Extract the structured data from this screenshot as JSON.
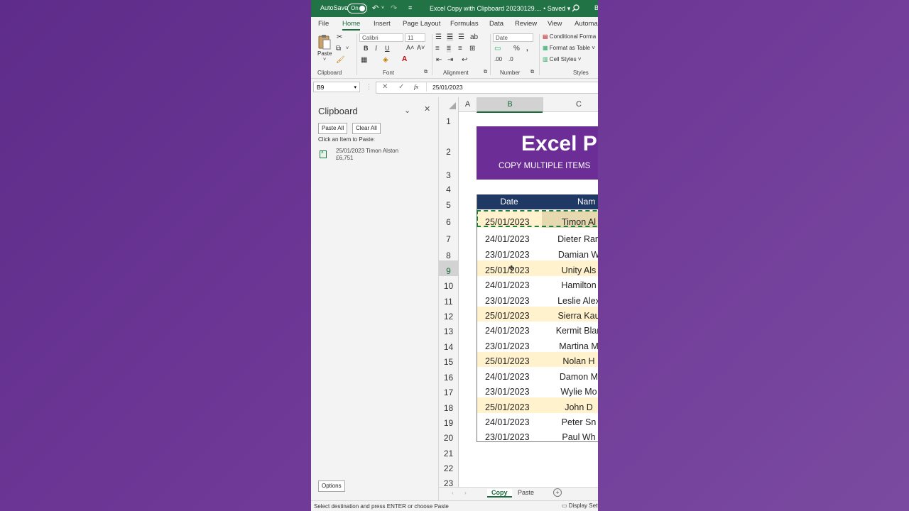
{
  "titlebar": {
    "autosave_label": "AutoSave",
    "toggle_state": "On",
    "doc_title": "Excel Copy with Clipboard 20230129.... • Saved ▾",
    "search_icon": "search-icon",
    "accent_color": "#217346"
  },
  "ribbon_tabs": [
    "File",
    "Home",
    "Insert",
    "Page Layout",
    "Formulas",
    "Data",
    "Review",
    "View",
    "Automa"
  ],
  "ribbon": {
    "paste_label": "Paste",
    "font_name": "Calibri",
    "font_size": "11",
    "number_format": "Date",
    "bold": "B",
    "italic": "I",
    "underline": "U",
    "conditional_formatting": "Conditional Forma",
    "format_as_table": "Format as Table ˅",
    "cell_styles": "Cell Styles ˅",
    "groups": {
      "clipboard": "Clipboard",
      "font": "Font",
      "alignment": "Alignment",
      "number": "Number",
      "styles": "Styles"
    }
  },
  "formula_bar": {
    "name_box": "B9",
    "fx": "fx",
    "value": "25/01/2023"
  },
  "clipboard_pane": {
    "title": "Clipboard",
    "paste_all": "Paste All",
    "clear_all": "Clear All",
    "hint": "Click an Item to Paste:",
    "item_line1": "25/01/2023 Timon Alston",
    "item_line2": "£6,751",
    "options": "Options"
  },
  "grid": {
    "columns": [
      "A",
      "B",
      "C"
    ],
    "rows": [
      "1",
      "2",
      "3",
      "4",
      "5",
      "6",
      "7",
      "8",
      "9",
      "10",
      "11",
      "12",
      "13",
      "14",
      "15",
      "16",
      "17",
      "18",
      "19",
      "20",
      "21",
      "22",
      "23"
    ],
    "banner_title": "Excel Pr",
    "banner_subtitle": "COPY MULTIPLE ITEMS",
    "banner_color": "#6c2d97",
    "header_color": "#1f3864",
    "highlight_color": "#fff2cc",
    "table_headers": [
      "Date",
      "Nam"
    ],
    "table_rows": [
      {
        "date": "25/01/2023",
        "name": "Timon Al",
        "highlight": true
      },
      {
        "date": "24/01/2023",
        "name": "Dieter Ran",
        "highlight": false
      },
      {
        "date": "23/01/2023",
        "name": "Damian W",
        "highlight": false
      },
      {
        "date": "25/01/2023",
        "name": "Unity Als",
        "highlight": true
      },
      {
        "date": "24/01/2023",
        "name": "Hamilton",
        "highlight": false
      },
      {
        "date": "23/01/2023",
        "name": "Leslie Alex",
        "highlight": false
      },
      {
        "date": "25/01/2023",
        "name": "Sierra Kau",
        "highlight": true
      },
      {
        "date": "24/01/2023",
        "name": "Kermit Blan",
        "highlight": false
      },
      {
        "date": "23/01/2023",
        "name": "Martina M",
        "highlight": false
      },
      {
        "date": "25/01/2023",
        "name": "Nolan H",
        "highlight": true
      },
      {
        "date": "24/01/2023",
        "name": "Damon M",
        "highlight": false
      },
      {
        "date": "23/01/2023",
        "name": "Wylie Mo",
        "highlight": false
      },
      {
        "date": "25/01/2023",
        "name": "John D",
        "highlight": true
      },
      {
        "date": "24/01/2023",
        "name": "Peter Sn",
        "highlight": false
      },
      {
        "date": "23/01/2023",
        "name": "Paul Wh",
        "highlight": false
      }
    ]
  },
  "sheet_tabs": {
    "active": "Copy",
    "other": "Paste",
    "add": "+"
  },
  "status_bar": {
    "message": "Select destination and press ENTER or choose Paste",
    "display_settings": "Display Sett"
  }
}
